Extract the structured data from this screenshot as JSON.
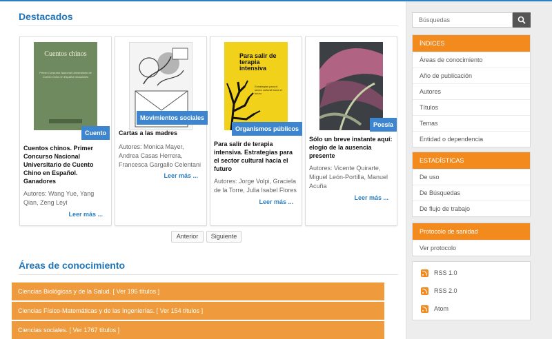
{
  "featured": {
    "title": "Destacados",
    "cards": [
      {
        "cover_title": "Cuentos chinos",
        "cover_subtitle": "Primer Concurso Nacional Universitario de Cuento Chino en Español Ganadores",
        "tag": "Cuento",
        "title": "Cuentos chinos. Primer Concurso Nacional Universitario de Cuento Chino en Español. Ganadores",
        "authors": "Autores: Wang Yue, Yang Qian, Zeng Leyi",
        "more": "Leer más ..."
      },
      {
        "tag": "Movimientos sociales",
        "title": "Cartas a las madres",
        "authors": "Autores: Monica Mayer, Andrea Casas Herrera, Francesca Gargallo Celentani",
        "more": "Leer más ..."
      },
      {
        "cover_title": "Para salir de terapia intensiva",
        "cover_subtitle": "Estrategias para el sector cultural hacia el futuro",
        "tag": "Organismos públicos",
        "title": "Para salir de terapia intensiva. Estrategias para el sector cultural hacia el futuro",
        "authors": "Autores: Jorge Volpi, Graciela de la Torre, Julia Isabel Flores",
        "more": "Leer más ..."
      },
      {
        "tag": "Poesía",
        "title": "Sólo un breve instante aquí: elogio de la ausencia presente",
        "authors": "Autores: Vicente Quirarte, Miguel León-Portilla, Manuel Acuña",
        "more": "Leer más ..."
      }
    ],
    "prev": "Anterior",
    "next": "Siguiente"
  },
  "areas": {
    "title": "Áreas de conocimiento",
    "rows": [
      {
        "name": "Ciencias Biológicas y de la Salud.",
        "count": "[ Ver 195 títulos ]"
      },
      {
        "name": "Ciencias Físico-Matemáticas y de las Ingenierías.",
        "count": "[ Ver 154 títulos ]"
      },
      {
        "name": "Ciencias sociales.",
        "count": "[ Ver 1767 títulos ]"
      }
    ]
  },
  "sidebar": {
    "search_placeholder": "Búsquedas",
    "indices": {
      "head": "ÍNDICES",
      "items": [
        "Áreas de conocimiento",
        "Año de publicación",
        "Autores",
        "Títulos",
        "Temas",
        "Entidad o dependencia"
      ]
    },
    "stats": {
      "head": "ESTADÍSTICAS",
      "items": [
        "De uso",
        "De Búsquedas",
        "De flujo de trabajo"
      ]
    },
    "protocol": {
      "head": "Protocolo de sanidad",
      "items": [
        "Ver protocolo"
      ]
    },
    "feeds": [
      "RSS 1.0",
      "RSS 2.0",
      "Atom"
    ]
  }
}
